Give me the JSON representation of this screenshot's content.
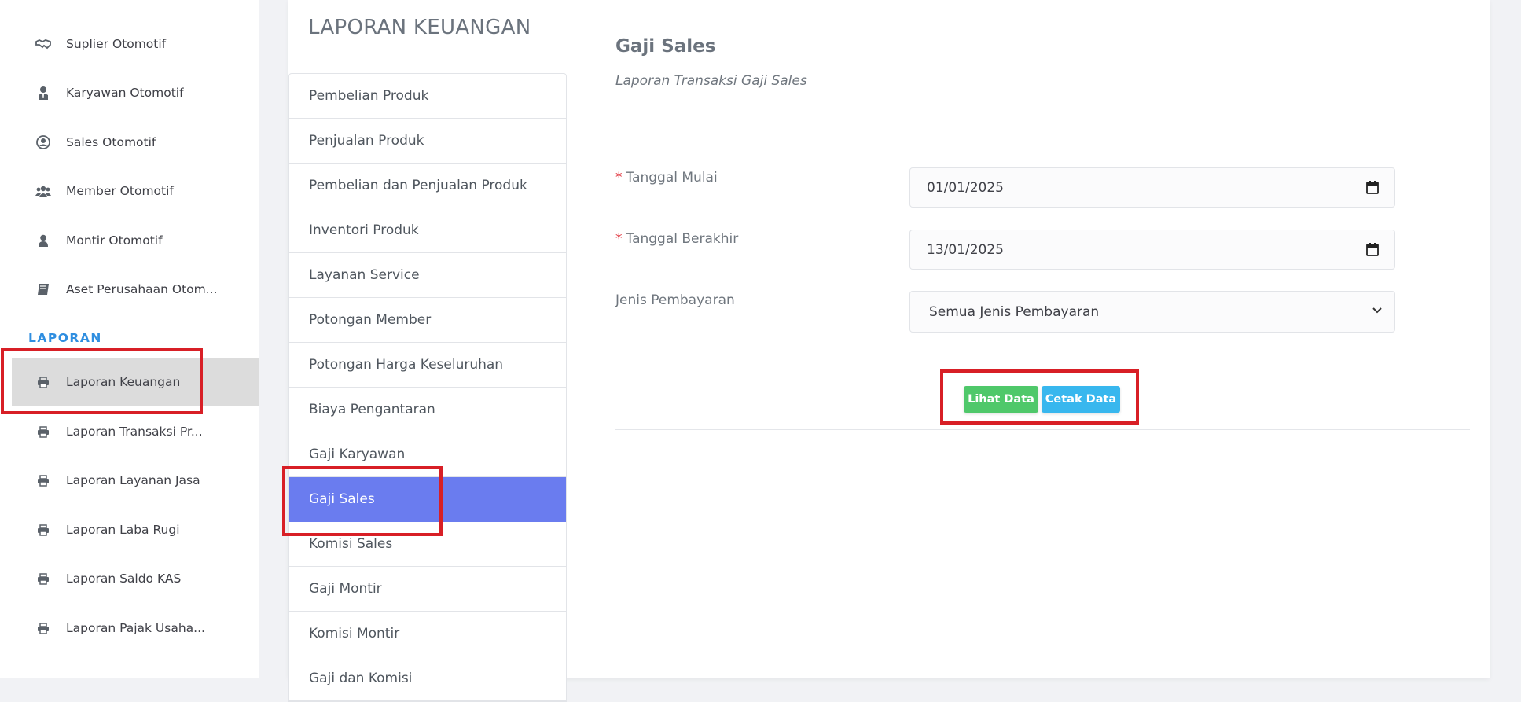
{
  "sidebar": {
    "items": [
      {
        "label": "Suplier Otomotif",
        "icon": "handshake-icon"
      },
      {
        "label": "Karyawan Otomotif",
        "icon": "user-tie-icon"
      },
      {
        "label": "Sales Otomotif",
        "icon": "user-circle-icon"
      },
      {
        "label": "Member Otomotif",
        "icon": "users-icon"
      },
      {
        "label": "Montir Otomotif",
        "icon": "user-icon"
      },
      {
        "label": "Aset Perusahaan Otom...",
        "icon": "book-icon"
      }
    ],
    "section_heading": "LAPORAN",
    "report_items": [
      {
        "label": "Laporan Keuangan",
        "icon": "print-icon",
        "active": true
      },
      {
        "label": "Laporan Transaksi Pr...",
        "icon": "print-icon"
      },
      {
        "label": "Laporan Layanan Jasa",
        "icon": "print-icon"
      },
      {
        "label": "Laporan Laba Rugi",
        "icon": "print-icon"
      },
      {
        "label": "Laporan Saldo KAS",
        "icon": "print-icon"
      },
      {
        "label": "Laporan Pajak Usaha...",
        "icon": "print-icon"
      }
    ]
  },
  "card": {
    "title": "LAPORAN KEUANGAN"
  },
  "menu": {
    "items": [
      {
        "label": "Pembelian Produk"
      },
      {
        "label": "Penjualan Produk"
      },
      {
        "label": "Pembelian dan Penjualan Produk"
      },
      {
        "label": "Inventori Produk"
      },
      {
        "label": "Layanan Service"
      },
      {
        "label": "Potongan Member"
      },
      {
        "label": "Potongan Harga Keseluruhan"
      },
      {
        "label": "Biaya Pengantaran"
      },
      {
        "label": "Gaji Karyawan"
      },
      {
        "label": "Gaji Sales",
        "active": true
      },
      {
        "label": "Komisi Sales"
      },
      {
        "label": "Gaji Montir"
      },
      {
        "label": "Komisi Montir"
      },
      {
        "label": "Gaji dan Komisi"
      }
    ]
  },
  "form": {
    "title": "Gaji Sales",
    "subtitle": "Laporan Transaksi Gaji Sales",
    "required_mark": "*",
    "start_label": "Tanggal Mulai",
    "start_value": "01/01/2025",
    "end_label": "Tanggal Berakhir",
    "end_value": "13/01/2025",
    "payment_label": "Jenis Pembayaran",
    "payment_value": "Semua Jenis Pembayaran",
    "view_button": "Lihat Data",
    "print_button": "Cetak Data"
  },
  "colors": {
    "accent": "#6a7cef",
    "heading": "#2f8ee0",
    "highlight": "#d81f26",
    "green": "#4fc86a",
    "blue": "#38b7ee"
  }
}
